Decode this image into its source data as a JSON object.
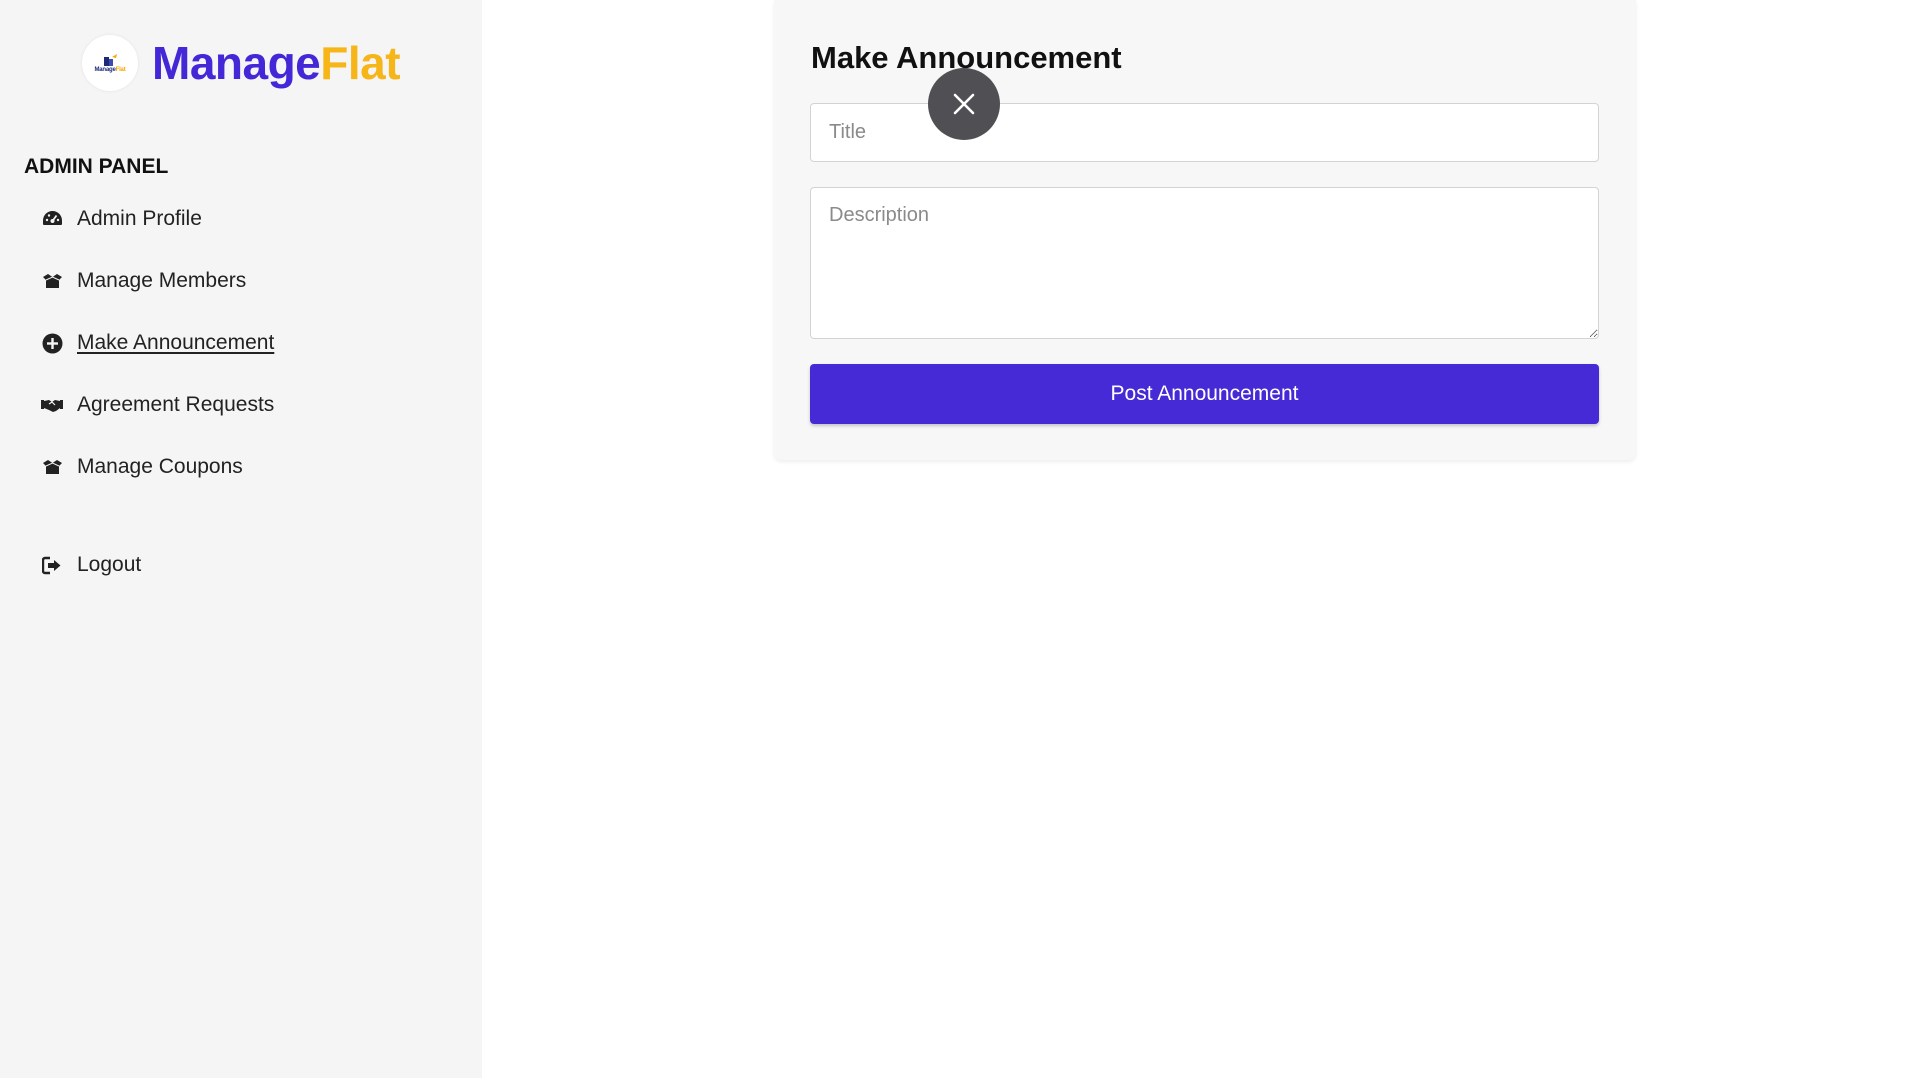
{
  "brand": {
    "logo_text_main": "Manage",
    "logo_text_accent": "Flat",
    "name_first": "Manage",
    "name_second": "Flat"
  },
  "sidebar": {
    "heading": "ADMIN PANEL",
    "items": [
      {
        "label": "Admin Profile",
        "icon": "dashboard-gauge-icon"
      },
      {
        "label": "Manage Members",
        "icon": "box-open-icon"
      },
      {
        "label": "Make Announcement",
        "icon": "plus-circle-icon",
        "active": true
      },
      {
        "label": "Agreement Requests",
        "icon": "handshake-icon"
      },
      {
        "label": "Manage Coupons",
        "icon": "box-open-icon"
      }
    ],
    "logout_label": "Logout"
  },
  "form": {
    "title": "Make Announcement",
    "title_placeholder": "Title",
    "description_placeholder": "Description",
    "submit_label": "Post Announcement"
  },
  "colors": {
    "brand_primary": "#4427d6",
    "brand_accent": "#f6b61a",
    "button_bg": "#452ad6",
    "sidebar_bg": "#f5f5f5",
    "overlay_close_bg": "#505054"
  }
}
